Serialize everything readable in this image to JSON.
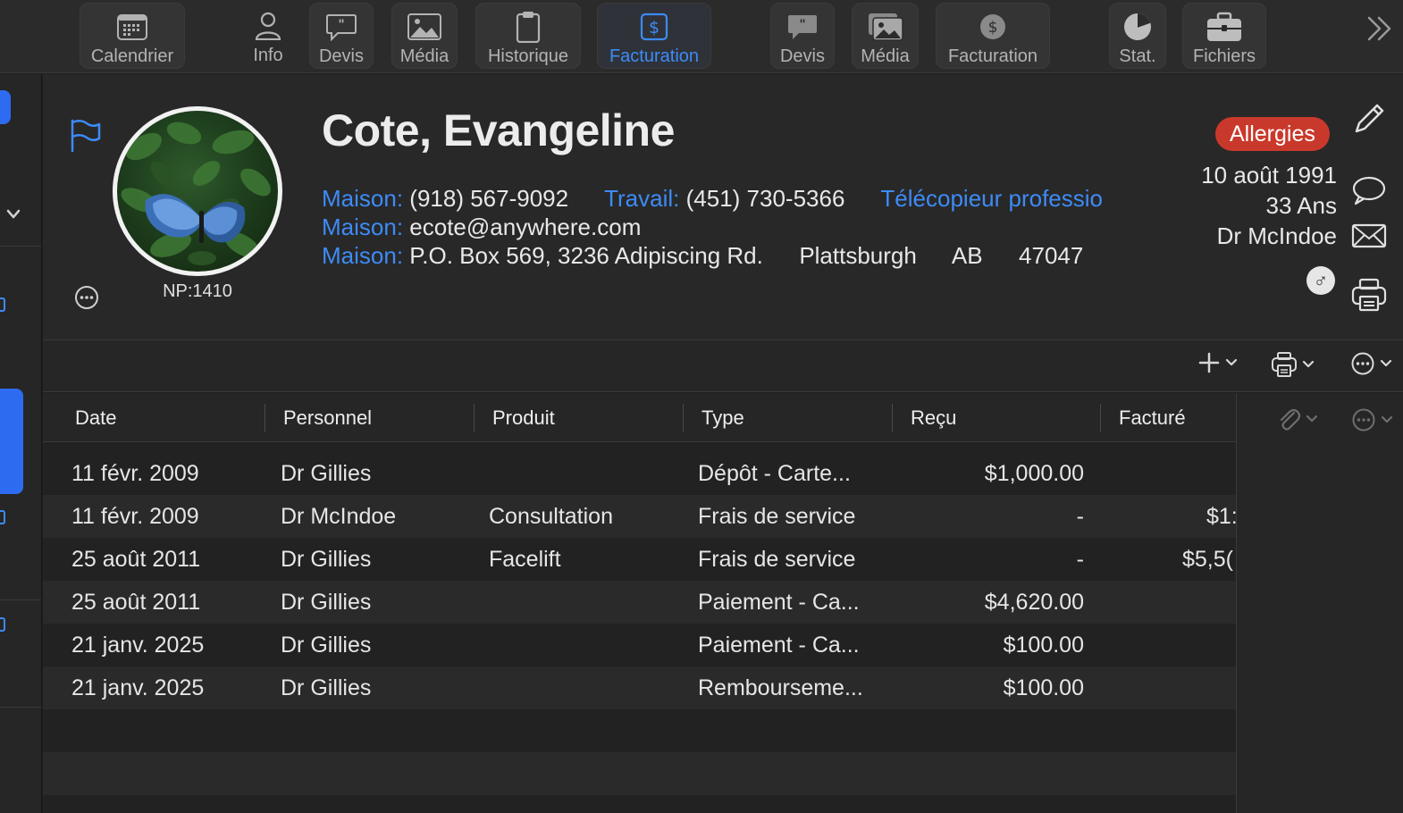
{
  "toolbar": {
    "items": [
      {
        "label": "Calendrier",
        "icon": "calendar-icon"
      },
      {
        "label": "Info",
        "icon": "person-icon"
      },
      {
        "label": "Devis",
        "icon": "quote-bubble-icon"
      },
      {
        "label": "Média",
        "icon": "photo-icon"
      },
      {
        "label": "Historique",
        "icon": "clipboard-icon"
      },
      {
        "label": "Facturation",
        "icon": "dollar-doc-icon",
        "active": true
      },
      {
        "label": "Devis",
        "icon": "quote-bubble-icon"
      },
      {
        "label": "Média",
        "icon": "photos-icon"
      },
      {
        "label": "Facturation",
        "icon": "dollar-circle-icon"
      },
      {
        "label": "Stat.",
        "icon": "pie-chart-icon"
      },
      {
        "label": "Fichiers",
        "icon": "briefcase-icon"
      }
    ],
    "accent": "#3d8bf7"
  },
  "patient": {
    "name": "Cote, Evangeline",
    "np": "NP:1410",
    "phone_home_label": "Maison:",
    "phone_home": "(918) 567-9092",
    "phone_work_label": "Travail:",
    "phone_work": "(451) 730-5366",
    "fax_label": "Télécopieur professio",
    "email_label": "Maison:",
    "email": "ecote@anywhere.com",
    "address_label": "Maison:",
    "address": "P.O. Box 569, 3236 Adipiscing Rd.",
    "city": "Plattsburgh",
    "province": "AB",
    "postal": "47047",
    "allergy_badge": "Allergies",
    "allergy_color": "#c9392b",
    "birthdate": "10 août 1991",
    "age": "33 Ans",
    "doctor": "Dr McIndoe",
    "gender_symbol": "♂"
  },
  "table": {
    "columns": [
      "Date",
      "Personnel",
      "Produit",
      "Type",
      "Reçu",
      "Facturé"
    ],
    "rows": [
      {
        "date": "11 févr. 2009",
        "staff": "Dr Gillies",
        "product": "",
        "type": "Dépôt - Carte...",
        "received": "$1,000.00",
        "billed": ""
      },
      {
        "date": "11 févr. 2009",
        "staff": "Dr McIndoe",
        "product": "Consultation",
        "type": "Frais de service",
        "received": "-",
        "billed": "$1:"
      },
      {
        "date": "25 août 2011",
        "staff": "Dr Gillies",
        "product": "Facelift",
        "type": "Frais de service",
        "received": "-",
        "billed": "$5,5("
      },
      {
        "date": "25 août 2011",
        "staff": "Dr Gillies",
        "product": "",
        "type": "Paiement - Ca...",
        "received": "$4,620.00",
        "billed": ""
      },
      {
        "date": "21 janv. 2025",
        "staff": "Dr Gillies",
        "product": "",
        "type": "Paiement - Ca...",
        "received": "$100.00",
        "billed": ""
      },
      {
        "date": "21 janv. 2025",
        "staff": "Dr Gillies",
        "product": "",
        "type": "Rembourseme...",
        "received": "$100.00",
        "billed": ""
      }
    ]
  }
}
